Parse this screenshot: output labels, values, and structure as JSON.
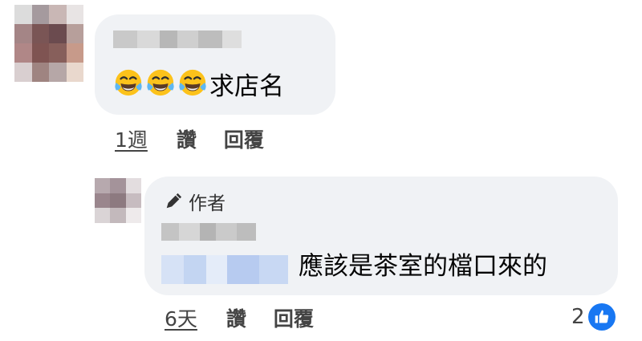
{
  "comment": {
    "emoji_count": 3,
    "emoji_name": "face-with-tears-of-joy",
    "text": "求店名",
    "time": "1週",
    "like_label": "讚",
    "reply_label": "回覆"
  },
  "reply": {
    "badge": "作者",
    "text": "應該是茶室的檔口來的",
    "time": "6天",
    "like_label": "讚",
    "reply_label": "回覆",
    "reaction_count": "2",
    "reaction_icon": "thumbs-up-icon"
  },
  "colors": {
    "bubble": "#f0f2f5",
    "like_blue": "#1877f2",
    "text": "#050505",
    "secondary": "#65676b"
  }
}
